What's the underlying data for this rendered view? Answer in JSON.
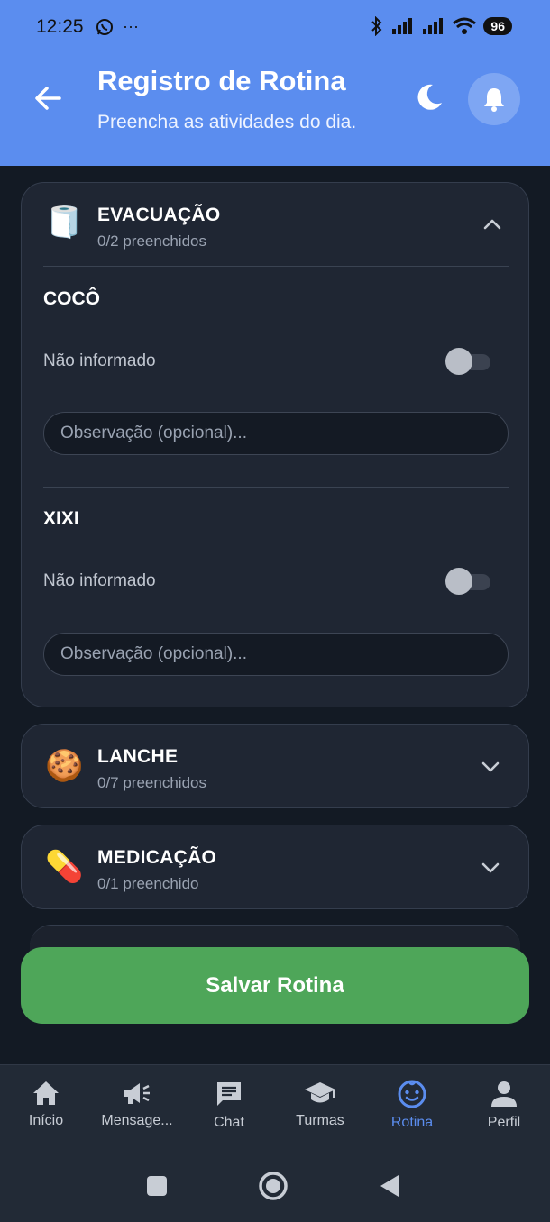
{
  "status_bar": {
    "time": "12:25",
    "more": "···",
    "battery": "96"
  },
  "header": {
    "title": "Registro de Rotina",
    "subtitle": "Preencha as atividades do dia.",
    "background_color": "#5b8def"
  },
  "sections": [
    {
      "emoji": "🧻",
      "title": "EVACUAÇÃO",
      "count": "0/2 preenchidos",
      "expanded": true,
      "items": [
        {
          "title": "COCÔ",
          "toggle_label": "Não informado",
          "toggle_on": false,
          "observation_placeholder": "Observação (opcional)...",
          "observation_value": ""
        },
        {
          "title": "XIXI",
          "toggle_label": "Não informado",
          "toggle_on": false,
          "observation_placeholder": "Observação (opcional)...",
          "observation_value": ""
        }
      ]
    },
    {
      "emoji": "🍪",
      "title": "LANCHE",
      "count": "0/7 preenchidos",
      "expanded": false
    },
    {
      "emoji": "💊",
      "title": "MEDICAÇÃO",
      "count": "0/1 preenchido",
      "expanded": false
    }
  ],
  "save_button": {
    "label": "Salvar Rotina",
    "color": "#4ea659"
  },
  "bottom_nav": [
    {
      "label": "Início",
      "icon": "home-icon",
      "active": false
    },
    {
      "label": "Mensage...",
      "icon": "megaphone-icon",
      "active": false
    },
    {
      "label": "Chat",
      "icon": "chat-icon",
      "active": false
    },
    {
      "label": "Turmas",
      "icon": "graduation-cap-icon",
      "active": false
    },
    {
      "label": "Rotina",
      "icon": "baby-face-icon",
      "active": true
    },
    {
      "label": "Perfil",
      "icon": "person-icon",
      "active": false
    }
  ],
  "accent_color": "#5b8def"
}
